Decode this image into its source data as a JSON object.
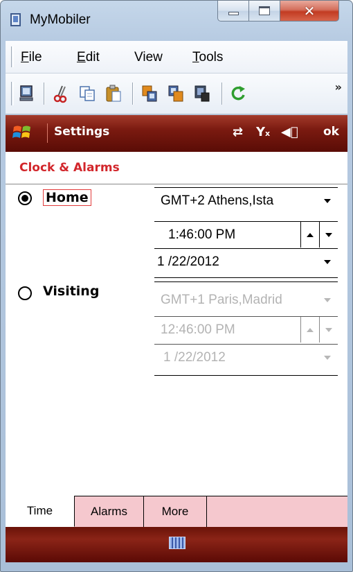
{
  "window": {
    "title": "MyMobiler"
  },
  "menu": {
    "items": [
      {
        "pre": "",
        "u": "F",
        "post": "ile"
      },
      {
        "pre": "",
        "u": "E",
        "post": "dit"
      },
      {
        "pre": "",
        "u": "V",
        "post": "iew"
      },
      {
        "pre": "",
        "u": "T",
        "post": "ools"
      }
    ]
  },
  "toolbar": {
    "overflow": "»"
  },
  "device": {
    "app_title": "Settings",
    "ok_label": "ok",
    "page_title": "Clock & Alarms",
    "home": {
      "label": "Home",
      "selected": true,
      "timezone": "GMT+2 Athens,Ista",
      "time": "1:46:00 PM",
      "date": "1 /22/2012"
    },
    "visiting": {
      "label": "Visiting",
      "selected": false,
      "timezone": "GMT+1 Paris,Madrid",
      "time": "12:46:00 PM",
      "date": "1 /22/2012"
    },
    "tabs": [
      "Time",
      "Alarms",
      "More"
    ],
    "active_tab": "Time"
  },
  "colors": {
    "accent_red": "#d2262b",
    "wm_bar": "#7a1a10",
    "tab_bg": "#f5c8ce"
  }
}
